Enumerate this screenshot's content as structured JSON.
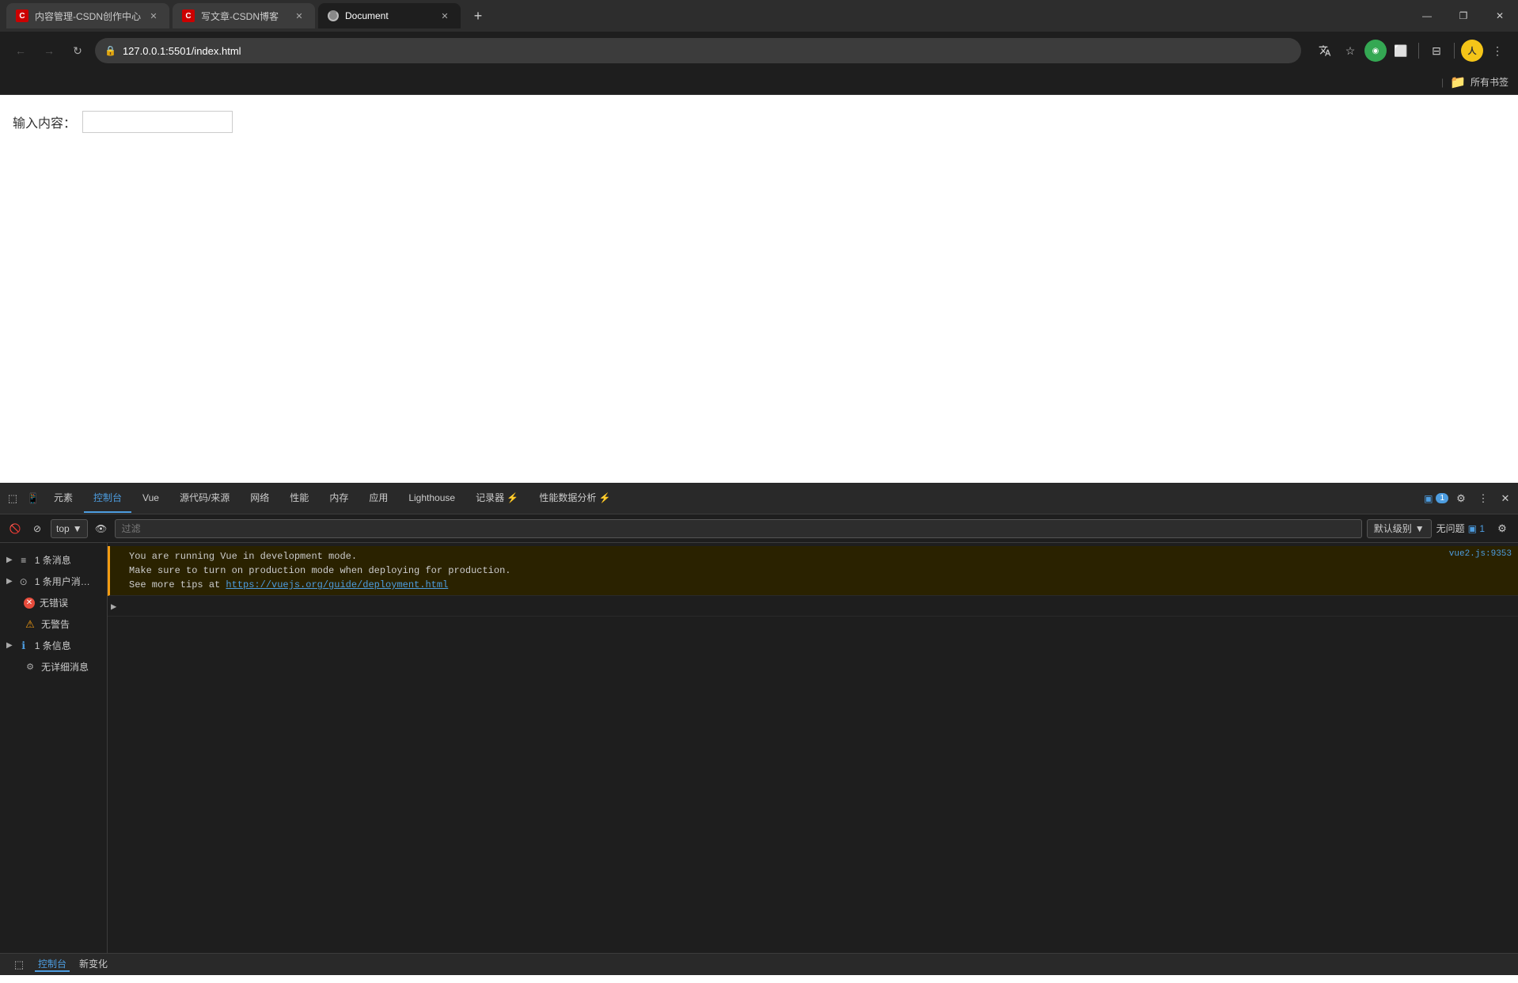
{
  "browser": {
    "tabs": [
      {
        "id": "tab1",
        "favicon": "C",
        "favicon_class": "csdn",
        "title": "内容管理-CSDN创作中心",
        "active": false
      },
      {
        "id": "tab2",
        "favicon": "C",
        "favicon_class": "csdn",
        "title": "写文章-CSDN博客",
        "active": false
      },
      {
        "id": "tab3",
        "favicon": "●",
        "favicon_class": "loading",
        "title": "Document",
        "active": true
      }
    ],
    "new_tab_label": "+",
    "address": "127.0.0.1:5501/index.html",
    "window_controls": {
      "minimize": "—",
      "maximize": "❐",
      "close": "✕"
    },
    "bookmarks_label": "所有书签"
  },
  "page": {
    "label": "输入内容：",
    "input_placeholder": ""
  },
  "devtools": {
    "tabs": [
      {
        "id": "elements",
        "label": "元素",
        "active": false
      },
      {
        "id": "console",
        "label": "控制台",
        "active": true
      },
      {
        "id": "vue",
        "label": "Vue",
        "active": false
      },
      {
        "id": "sources",
        "label": "源代码/来源",
        "active": false
      },
      {
        "id": "network",
        "label": "网络",
        "active": false
      },
      {
        "id": "performance",
        "label": "性能",
        "active": false
      },
      {
        "id": "memory",
        "label": "内存",
        "active": false
      },
      {
        "id": "application",
        "label": "应用",
        "active": false
      },
      {
        "id": "lighthouse",
        "label": "Lighthouse",
        "active": false
      },
      {
        "id": "recorder",
        "label": "记录器 ⚡",
        "active": false
      },
      {
        "id": "performance-insights",
        "label": "性能数据分析 ⚡",
        "active": false
      }
    ],
    "top_actions": {
      "issues_badge": "1",
      "issues_label": "▣ 1"
    },
    "bar2": {
      "context": "top",
      "filter_placeholder": "过滤",
      "level": "默认级别",
      "no_issues_label": "无问题",
      "issues_count": "▣ 1"
    },
    "sidebar": {
      "items": [
        {
          "id": "messages",
          "expand": true,
          "icon": "≡",
          "icon_class": "",
          "label": "1 条消息"
        },
        {
          "id": "user-messages",
          "expand": true,
          "icon": "⊙",
          "icon_class": "icon-user",
          "label": "1 条用户消…"
        },
        {
          "id": "errors",
          "expand": false,
          "icon": "✕",
          "icon_class": "icon-error",
          "label": "无错误"
        },
        {
          "id": "warnings",
          "expand": false,
          "icon": "⚠",
          "icon_class": "icon-warn",
          "label": "无警告"
        },
        {
          "id": "info",
          "expand": true,
          "icon": "ℹ",
          "icon_class": "icon-info",
          "label": "1 条信息"
        },
        {
          "id": "verbose",
          "expand": false,
          "icon": "⚙",
          "icon_class": "icon-gear",
          "label": "无详细消息"
        }
      ]
    },
    "console_messages": [
      {
        "id": "msg1",
        "type": "warning",
        "has_expand": false,
        "lines": [
          "You are running Vue in development mode.",
          "Make sure to turn on production mode when deploying for production.",
          "See more tips at https://vuejs.org/guide/deployment.html"
        ],
        "link_text": "https://vuejs.org/guide/deployment.html",
        "file_ref": "vue2.js:9353"
      },
      {
        "id": "msg2",
        "type": "expand",
        "has_expand": true,
        "lines": [
          ""
        ],
        "link_text": "",
        "file_ref": ""
      }
    ],
    "bottom_bar": {
      "console_label": "控制台",
      "new_changes_label": "新变化"
    }
  }
}
